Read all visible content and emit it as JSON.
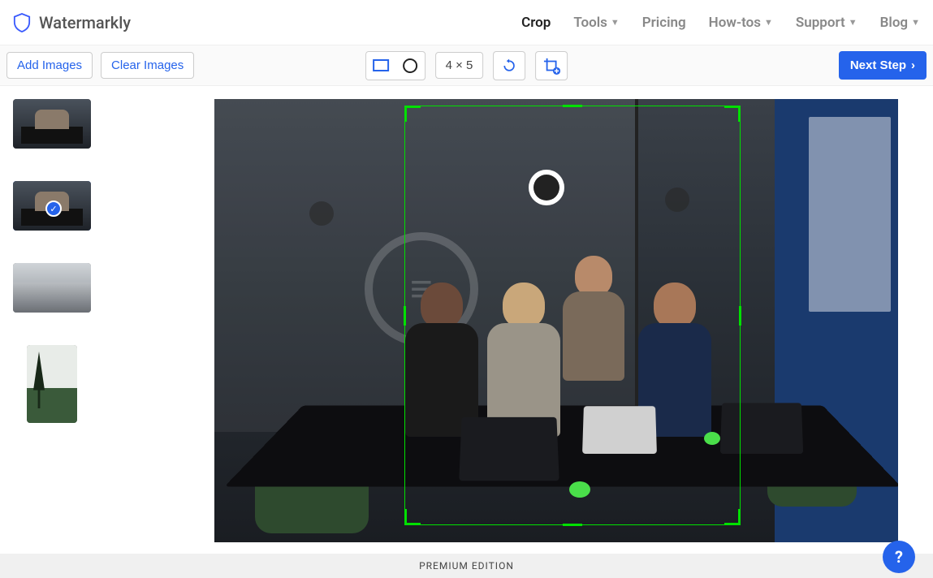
{
  "brand": {
    "name": "Watermarkly"
  },
  "nav": {
    "crop": "Crop",
    "tools": "Tools",
    "pricing": "Pricing",
    "howtos": "How-tos",
    "support": "Support",
    "blog": "Blog"
  },
  "toolbar": {
    "add_images": "Add Images",
    "clear_images": "Clear Images",
    "ratio": "4 × 5",
    "next_step": "Next Step"
  },
  "thumbnails": [
    {
      "name": "image-1",
      "orientation": "h",
      "selected": false
    },
    {
      "name": "image-2",
      "orientation": "h",
      "selected": true
    },
    {
      "name": "image-3",
      "orientation": "h",
      "selected": false
    },
    {
      "name": "image-4",
      "orientation": "v",
      "selected": false
    }
  ],
  "footer": {
    "edition": "PREMIUM EDITION"
  },
  "help": {
    "label": "?"
  },
  "crop_shape": "rectangle"
}
